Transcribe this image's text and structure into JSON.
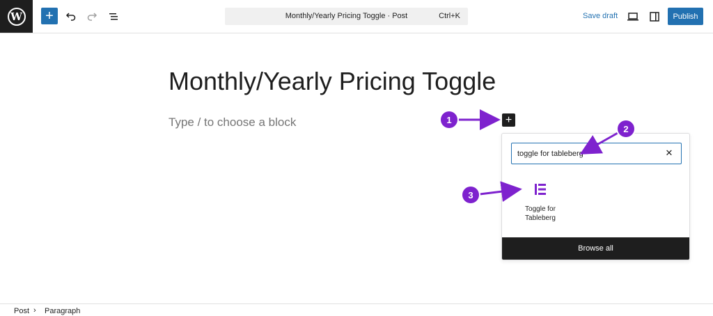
{
  "toolbar": {
    "logo_icon": "wordpress-logo",
    "add_block_icon": "plus-icon",
    "undo_icon": "undo-icon",
    "redo_icon": "redo-icon",
    "document_overview_icon": "list-view-icon",
    "command_title": "Monthly/Yearly Pricing Toggle · Post",
    "command_shortcut": "Ctrl+K",
    "save_draft_label": "Save draft",
    "preview_icon": "desktop-preview-icon",
    "settings_icon": "sidebar-settings-icon",
    "publish_label": "Publish",
    "accent_color": "#2271b1"
  },
  "editor": {
    "post_title": "Monthly/Yearly Pricing Toggle",
    "paragraph_placeholder": "Type / to choose a block",
    "inserter_icon": "plus-icon"
  },
  "inserter": {
    "search_value": "toggle for tableberg",
    "clear_icon": "close-icon",
    "results": [
      {
        "label_line1": "Toggle for",
        "label_line2": "Tableberg",
        "icon": "toggle-list-icon",
        "icon_color": "#7e22ce"
      }
    ],
    "browse_all_label": "Browse all"
  },
  "annotations": {
    "steps": [
      "1",
      "2",
      "3"
    ],
    "color": "#7e22ce"
  },
  "footer": {
    "breadcrumb": [
      "Post",
      "Paragraph"
    ],
    "separator": "›"
  }
}
